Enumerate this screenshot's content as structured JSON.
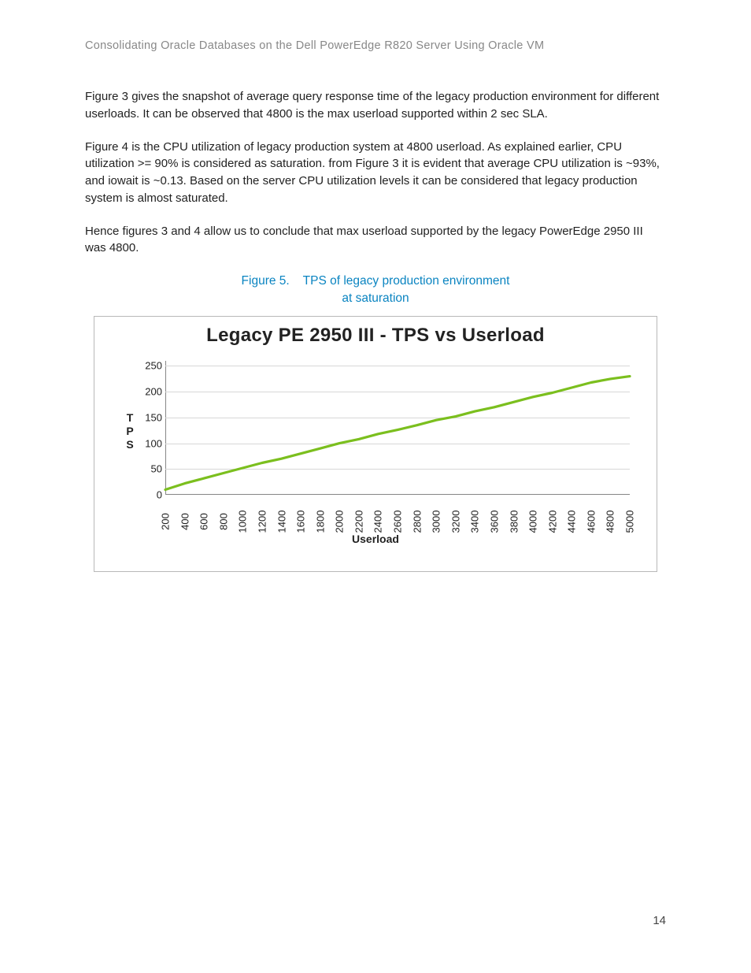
{
  "header": "Consolidating Oracle Databases on the Dell PowerEdge R820 Server Using Oracle VM",
  "paragraphs": {
    "p1": "Figure 3 gives the snapshot of average query response time of the legacy production environment for different userloads. It can be observed that 4800 is the max userload supported within 2 sec SLA.",
    "p2": "Figure 4 is the CPU utilization of legacy production system at 4800 userload. As explained earlier, CPU utilization >= 90% is considered as saturation. from Figure 3 it is evident that average CPU utilization is ~93%, and iowait is ~0.13. Based on the server CPU utilization levels it can be considered that legacy production system is almost saturated.",
    "p3": " Hence figures 3 and 4 allow us to conclude that max userload supported by the legacy PowerEdge 2950 III was 4800."
  },
  "figure_caption": {
    "label": "Figure 5.",
    "text_l1": "TPS of legacy production environment",
    "text_l2": "at saturation"
  },
  "chart_title": "Legacy PE 2950 III - TPS vs Userload",
  "y_label_chars": [
    "T",
    "P",
    "S"
  ],
  "x_label": "Userload",
  "page_number": "14",
  "chart_data": {
    "type": "line",
    "title": "Legacy PE 2950 III - TPS vs Userload",
    "xlabel": "Userload",
    "ylabel": "TPS",
    "ylim": [
      0,
      260
    ],
    "y_ticks": [
      0,
      50,
      100,
      150,
      200,
      250
    ],
    "x_ticks": [
      200,
      400,
      600,
      800,
      1000,
      1200,
      1400,
      1600,
      1800,
      2000,
      2200,
      2400,
      2600,
      2800,
      3000,
      3200,
      3400,
      3600,
      3800,
      4000,
      4200,
      4400,
      4600,
      4800,
      5000
    ],
    "x": [
      200,
      400,
      600,
      800,
      1000,
      1200,
      1400,
      1600,
      1800,
      2000,
      2200,
      2400,
      2600,
      2800,
      3000,
      3200,
      3400,
      3600,
      3800,
      4000,
      4200,
      4400,
      4600,
      4800,
      5000
    ],
    "values": [
      10,
      22,
      32,
      42,
      52,
      62,
      70,
      80,
      90,
      100,
      108,
      118,
      126,
      135,
      145,
      152,
      162,
      170,
      180,
      190,
      198,
      208,
      218,
      225,
      230
    ],
    "series_color": "#7bbf1e"
  }
}
